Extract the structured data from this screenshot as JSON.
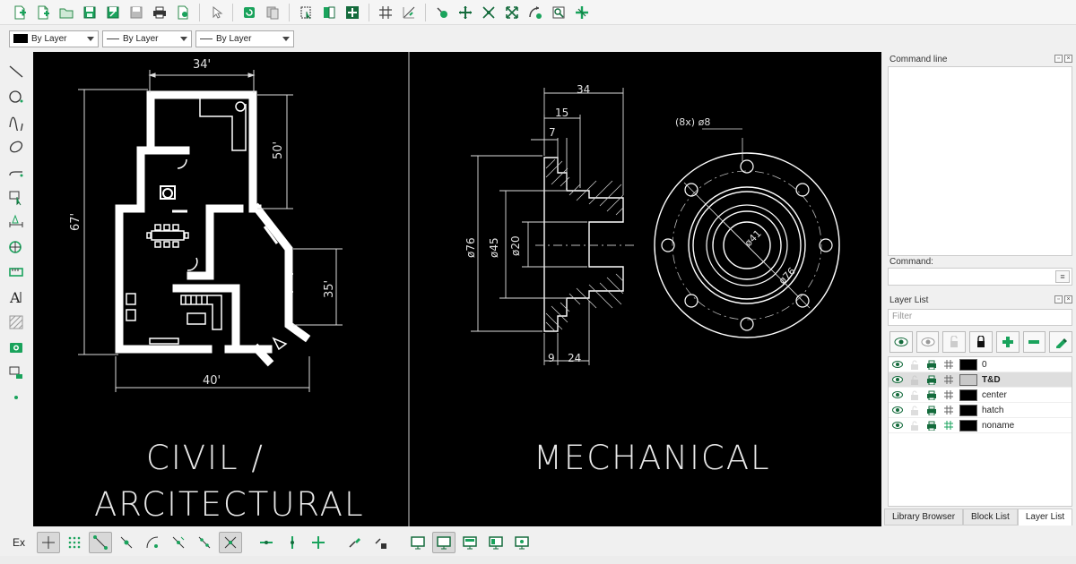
{
  "pen_toolbar": {
    "color_label": "By Layer",
    "width_label": "By Layer",
    "linetype_label": "By Layer"
  },
  "drawing": {
    "civil_title_line1": "CIVIL /",
    "civil_title_line2": "ARCITECTURAL",
    "mech_title": "MECHANICAL",
    "civil_dims": {
      "top": "34'",
      "right_upper": "50'",
      "left": "67'",
      "right_lower": "35'",
      "bottom": "40'"
    },
    "mech_dims": {
      "overall": "34",
      "flange": "15",
      "step": "7",
      "d1": "ø76",
      "d2": "ø45",
      "d3": "ø20",
      "b1": "9",
      "b2": "24",
      "holes": "(8x) ø8",
      "c1": "ø41",
      "c2": "ø76"
    }
  },
  "dock": {
    "command_line_title": "Command line",
    "command_label": "Command:",
    "layer_list_title": "Layer List",
    "filter_placeholder": "Filter",
    "layers": [
      {
        "name": "0",
        "color": "#000000"
      },
      {
        "name": "T&D",
        "color": "#c8c8c8"
      },
      {
        "name": "center",
        "color": "#000000"
      },
      {
        "name": "hatch",
        "color": "#000000"
      },
      {
        "name": "noname",
        "color": "#000000"
      }
    ],
    "tabs": [
      "Library Browser",
      "Block List",
      "Layer List"
    ]
  },
  "snap_toolbar": {
    "label": "Ex"
  },
  "colors": {
    "accent": "#1aa35c",
    "canvas": "#000000"
  }
}
